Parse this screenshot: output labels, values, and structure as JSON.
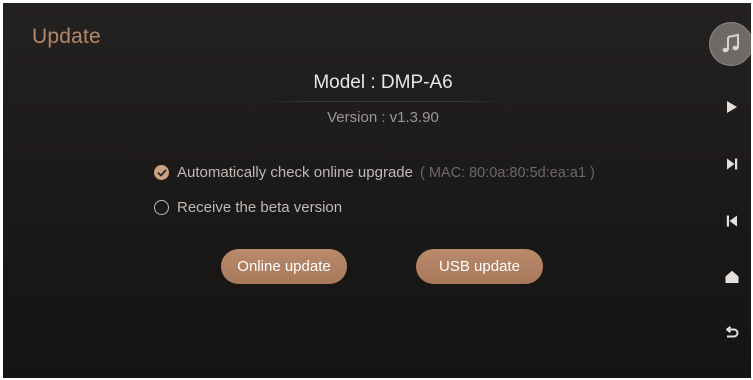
{
  "header": {
    "title": "Update"
  },
  "device": {
    "model": "Model : DMP-A6",
    "version": "Version : v1.3.90"
  },
  "options": {
    "auto_check": {
      "label": "Automatically check online upgrade",
      "mac": "( MAC: 80:0a:80:5d:ea:a1 )",
      "checked": true
    },
    "beta": {
      "label": "Receive the beta version",
      "checked": false
    }
  },
  "buttons": {
    "online_update": "Online update",
    "usb_update": "USB update"
  },
  "sidebar": {
    "icons": [
      "music-note-icon",
      "play-icon",
      "next-track-icon",
      "previous-track-icon",
      "home-icon",
      "back-icon"
    ]
  },
  "colors": {
    "accent": "#b58767",
    "button": "#b0805f",
    "background": "#1e1c1b"
  }
}
